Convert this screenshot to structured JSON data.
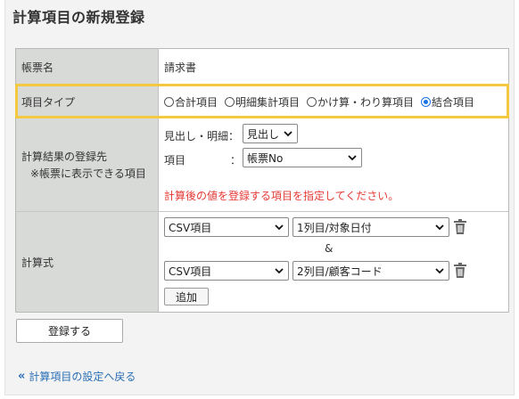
{
  "page": {
    "title": "計算項目の新規登録"
  },
  "form": {
    "report_name": {
      "label": "帳票名",
      "value": "請求書"
    },
    "item_type": {
      "label": "項目タイプ",
      "options": [
        "合計項目",
        "明細集計項目",
        "かけ算・わり算項目",
        "結合項目"
      ],
      "selected": "結合項目"
    },
    "destination": {
      "label": "計算結果の登録先",
      "sublabel": "※帳票に表示できる項目",
      "heading_detail_label": "見出し・明細：",
      "heading_detail_value": "見出し",
      "item_label": "項目",
      "item_colon": "：",
      "item_value": "帳票No",
      "hint": "計算後の値を登録する項目を指定してください。"
    },
    "formula": {
      "label": "計算式",
      "operand1_source": "CSV項目",
      "operand1_field": "1列目/対象日付",
      "operator": "&",
      "operand2_source": "CSV項目",
      "operand2_field": "2列目/顧客コード",
      "add_label": "追加"
    }
  },
  "actions": {
    "submit_label": "登録する"
  },
  "back_link": {
    "label": "計算項目の設定へ戻る"
  },
  "colors": {
    "highlight": "#f5c842",
    "link": "#2a6fb5",
    "hint_red": "#e53935",
    "radio_selected": "#1a73e8"
  }
}
